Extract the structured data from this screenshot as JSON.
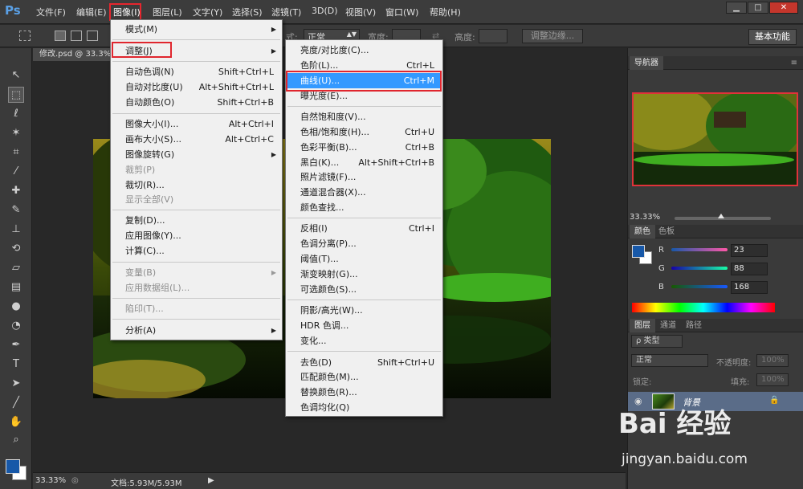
{
  "app": {
    "logo": "Ps"
  },
  "menubar": {
    "items": [
      {
        "label": "文件(F)"
      },
      {
        "label": "编辑(E)"
      },
      {
        "label": "图像(I)"
      },
      {
        "label": "图层(L)"
      },
      {
        "label": "文字(Y)"
      },
      {
        "label": "选择(S)"
      },
      {
        "label": "滤镜(T)"
      },
      {
        "label": "3D(D)"
      },
      {
        "label": "视图(V)"
      },
      {
        "label": "窗口(W)"
      },
      {
        "label": "帮助(H)"
      }
    ],
    "active_index": 2
  },
  "window_controls": {
    "minimize": "▁",
    "maximize": "□",
    "close": "✕"
  },
  "options": {
    "style_label": "式:",
    "style_value": "正常",
    "width_label": "宽度:",
    "height_label": "高度:",
    "refine_edge": "调整边缘...",
    "workspace": "基本功能"
  },
  "document": {
    "tab_title": "修改.psd @ 33.3%",
    "status_zoom": "33.33%",
    "status_doc": "文档:5.93M/5.93M"
  },
  "image_menu": {
    "items": [
      {
        "label": "模式(M)",
        "submenu": true
      },
      {
        "label": "调整(J)",
        "submenu": true,
        "highlight": true
      },
      {
        "label": "自动色调(N)",
        "shortcut": "Shift+Ctrl+L"
      },
      {
        "label": "自动对比度(U)",
        "shortcut": "Alt+Shift+Ctrl+L"
      },
      {
        "label": "自动颜色(O)",
        "shortcut": "Shift+Ctrl+B"
      },
      {
        "label": "图像大小(I)...",
        "shortcut": "Alt+Ctrl+I"
      },
      {
        "label": "画布大小(S)...",
        "shortcut": "Alt+Ctrl+C"
      },
      {
        "label": "图像旋转(G)",
        "submenu": true
      },
      {
        "label": "裁剪(P)",
        "disabled": true
      },
      {
        "label": "裁切(R)..."
      },
      {
        "label": "显示全部(V)",
        "disabled": true
      },
      {
        "label": "复制(D)..."
      },
      {
        "label": "应用图像(Y)..."
      },
      {
        "label": "计算(C)..."
      },
      {
        "label": "变量(B)",
        "submenu": true,
        "disabled": true
      },
      {
        "label": "应用数据组(L)...",
        "disabled": true
      },
      {
        "label": "陷印(T)...",
        "disabled": true
      },
      {
        "label": "分析(A)",
        "submenu": true
      }
    ]
  },
  "adjust_menu": {
    "items": [
      {
        "label": "亮度/对比度(C)..."
      },
      {
        "label": "色阶(L)...",
        "shortcut": "Ctrl+L"
      },
      {
        "label": "曲线(U)...",
        "shortcut": "Ctrl+M",
        "selected": true
      },
      {
        "label": "曝光度(E)..."
      },
      {
        "label": "自然饱和度(V)..."
      },
      {
        "label": "色相/饱和度(H)...",
        "shortcut": "Ctrl+U"
      },
      {
        "label": "色彩平衡(B)...",
        "shortcut": "Ctrl+B"
      },
      {
        "label": "黑白(K)...",
        "shortcut": "Alt+Shift+Ctrl+B"
      },
      {
        "label": "照片滤镜(F)..."
      },
      {
        "label": "通道混合器(X)..."
      },
      {
        "label": "颜色查找..."
      },
      {
        "label": "反相(I)",
        "shortcut": "Ctrl+I"
      },
      {
        "label": "色调分离(P)..."
      },
      {
        "label": "阈值(T)..."
      },
      {
        "label": "渐变映射(G)..."
      },
      {
        "label": "可选颜色(S)..."
      },
      {
        "label": "阴影/高光(W)..."
      },
      {
        "label": "HDR 色调..."
      },
      {
        "label": "变化..."
      },
      {
        "label": "去色(D)",
        "shortcut": "Shift+Ctrl+U"
      },
      {
        "label": "匹配颜色(M)..."
      },
      {
        "label": "替换颜色(R)..."
      },
      {
        "label": "色调均化(Q)"
      }
    ]
  },
  "navigator": {
    "tab": "导航器",
    "zoom": "33.33%"
  },
  "color_panel": {
    "tabs": [
      "颜色",
      "色板"
    ],
    "r_label": "R",
    "g_label": "G",
    "b_label": "B",
    "r": "23",
    "g": "88",
    "b": "168",
    "fg_color": "#1758a8",
    "bg_color": "#ffffff"
  },
  "layers_panel": {
    "tabs": [
      "图层",
      "通道",
      "路径"
    ],
    "filter_kind": "ρ 类型",
    "blend_mode": "正常",
    "opacity_label": "不透明度:",
    "opacity_value": "100%",
    "lock_label": "锁定:",
    "fill_label": "填充:",
    "fill_value": "100%",
    "layer_name": "背景"
  },
  "watermark": {
    "logo": "Bai 经验",
    "url": "jingyan.baidu.com"
  }
}
